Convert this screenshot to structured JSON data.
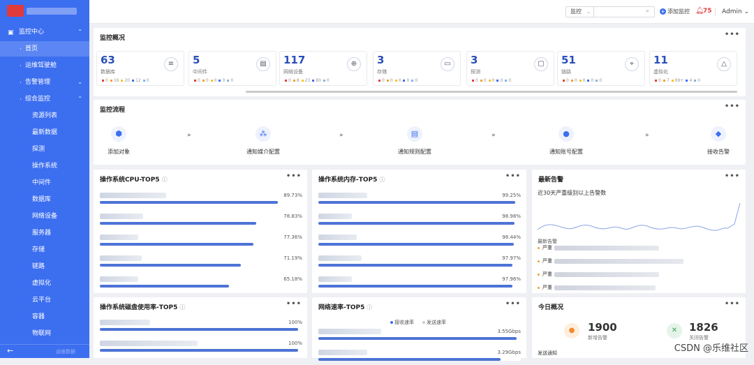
{
  "sidebar": {
    "items": [
      {
        "label": "监控中心",
        "icon": "monitor-icon",
        "caret": "⌃"
      },
      {
        "label": "首页"
      },
      {
        "label": "运维驾驶舱"
      },
      {
        "label": "告警管理",
        "caret": "⌄"
      },
      {
        "label": "综合监控",
        "caret": "⌃"
      },
      {
        "label": "资源列表"
      },
      {
        "label": "最新数据"
      },
      {
        "label": "探测"
      },
      {
        "label": "操作系统"
      },
      {
        "label": "中间件"
      },
      {
        "label": "数据库"
      },
      {
        "label": "网络设备"
      },
      {
        "label": "服务器"
      },
      {
        "label": "存储"
      },
      {
        "label": "链路"
      },
      {
        "label": "虚拟化"
      },
      {
        "label": "云平台"
      },
      {
        "label": "容器"
      },
      {
        "label": "物联网"
      }
    ],
    "footer": {
      "collapse_icon": "arrow-left-icon",
      "text": "运维数据"
    }
  },
  "topbar": {
    "search_select": "监控",
    "search_placeholder": "",
    "add_monitor": "添加监控",
    "alert_count": "75",
    "user": "Admin"
  },
  "overview": {
    "title": "监控概况",
    "menu": "•••",
    "cards": [
      {
        "value": "63",
        "label": "数据库",
        "icon": "database-icon",
        "stats": [
          "0",
          "16",
          "20",
          "12",
          "0"
        ]
      },
      {
        "value": "5",
        "label": "中间件",
        "icon": "middleware-icon",
        "stats": [
          "0",
          "0",
          "0",
          "0",
          "0"
        ]
      },
      {
        "value": "117",
        "label": "网络设备",
        "icon": "globe-icon",
        "stats": [
          "0",
          "8",
          "23",
          "80",
          "0"
        ]
      },
      {
        "value": "3",
        "label": "存储",
        "icon": "storage-icon",
        "stats": [
          "0",
          "0",
          "0",
          "0",
          "0"
        ]
      },
      {
        "value": "3",
        "label": "探测",
        "icon": "probe-icon",
        "stats": [
          "0",
          "0",
          "0",
          "0",
          "0"
        ]
      },
      {
        "value": "51",
        "label": "链路",
        "icon": "link-icon",
        "stats": [
          "0",
          "0",
          "0",
          "0",
          "0"
        ]
      },
      {
        "value": "11",
        "label": "虚拟化",
        "icon": "virtualization-icon",
        "stats": [
          "0",
          "7",
          "99+",
          "4",
          "0"
        ]
      }
    ],
    "stat_colors": [
      "#e04040",
      "#f0a030",
      "#f5c518",
      "#3c6ef0",
      "#7fb2e5"
    ]
  },
  "process": {
    "title": "监控流程",
    "menu": "•••",
    "chevron": "»",
    "steps": [
      {
        "label": "添加对象",
        "icon": "cube-icon"
      },
      {
        "label": "通知媒介配置",
        "icon": "network-nodes-icon"
      },
      {
        "label": "通知规则配置",
        "icon": "document-icon"
      },
      {
        "label": "通知账号配置",
        "icon": "user-icon"
      },
      {
        "label": "接收告警",
        "icon": "bell-icon"
      }
    ]
  },
  "cpu_top5": {
    "title": "操作系统CPU-TOP5",
    "info": "ⓘ",
    "menu": "•••",
    "rows": [
      {
        "value": "89.73%",
        "pct": 89.73
      },
      {
        "value": "78.83%",
        "pct": 78.83
      },
      {
        "value": "77.36%",
        "pct": 77.36
      },
      {
        "value": "71.19%",
        "pct": 71.19
      },
      {
        "value": "65.18%",
        "pct": 65.18
      }
    ]
  },
  "mem_top5": {
    "title": "操作系统内存-TOP5",
    "info": "ⓘ",
    "menu": "•••",
    "rows": [
      {
        "value": "99.25%",
        "pct": 99.25
      },
      {
        "value": "98.98%",
        "pct": 98.98
      },
      {
        "value": "98.44%",
        "pct": 98.44
      },
      {
        "value": "97.97%",
        "pct": 97.97
      },
      {
        "value": "97.96%",
        "pct": 97.96
      }
    ]
  },
  "alerts": {
    "title": "最新告警",
    "menu": "•••",
    "subtitle": "近30天严重级别以上告警数",
    "new_label": "最新告警",
    "rows": [
      {
        "level": "严重"
      },
      {
        "level": "严重"
      },
      {
        "level": "严重"
      },
      {
        "level": "严重"
      }
    ]
  },
  "disk_top5": {
    "title": "操作系统磁盘使用率-TOP5",
    "info": "ⓘ",
    "menu": "•••",
    "rows": [
      {
        "value": "100%",
        "pct": 100
      },
      {
        "value": "100%",
        "pct": 100
      }
    ]
  },
  "net_top5": {
    "title": "网络速率-TOP5",
    "info": "ⓘ",
    "menu": "•••",
    "legend": [
      {
        "label": "接收速率",
        "color": "#3c6ef0"
      },
      {
        "label": "发送速率",
        "color": "#c9ccd3"
      }
    ],
    "rows": [
      {
        "value": "3.55Gbps",
        "pct": 100
      },
      {
        "value": "3.29Gbps",
        "pct": 92
      }
    ]
  },
  "today": {
    "title": "今日概况",
    "menu": "•••",
    "new_alerts": {
      "value": "1900",
      "label": "新增告警"
    },
    "closed_alerts": {
      "value": "1826",
      "label": "关闭告警"
    },
    "notify_label": "发送通知"
  },
  "watermark": "CSDN @乐维社区"
}
